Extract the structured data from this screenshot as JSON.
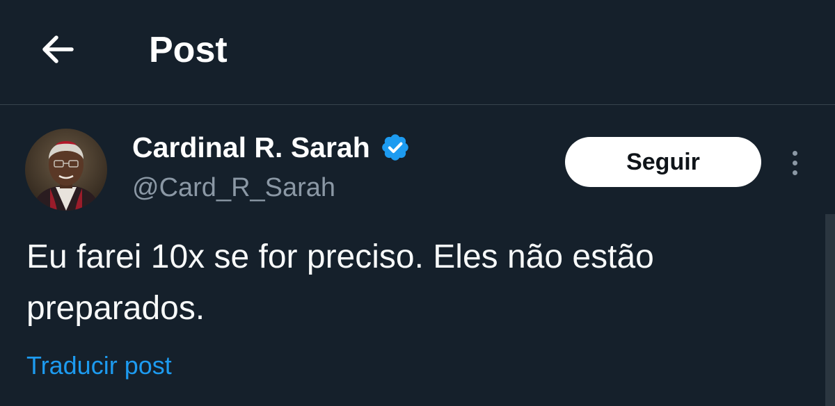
{
  "header": {
    "back_icon": "arrow-left-icon",
    "title": "Post"
  },
  "author": {
    "name": "Cardinal R. Sarah",
    "handle": "@Card_R_Sarah",
    "verified": true,
    "verified_icon": "verified-badge-icon",
    "verified_color": "#1d9bf0"
  },
  "actions": {
    "follow_label": "Seguir",
    "more_icon": "more-vertical-icon"
  },
  "post": {
    "text": "Eu farei 10x se for preciso. Eles não estão preparados.",
    "translate_label": "Traducir post"
  },
  "colors": {
    "background": "#15202b",
    "text": "#ffffff",
    "secondary_text": "#8b98a5",
    "accent": "#1d9bf0",
    "divider": "#38444d"
  }
}
